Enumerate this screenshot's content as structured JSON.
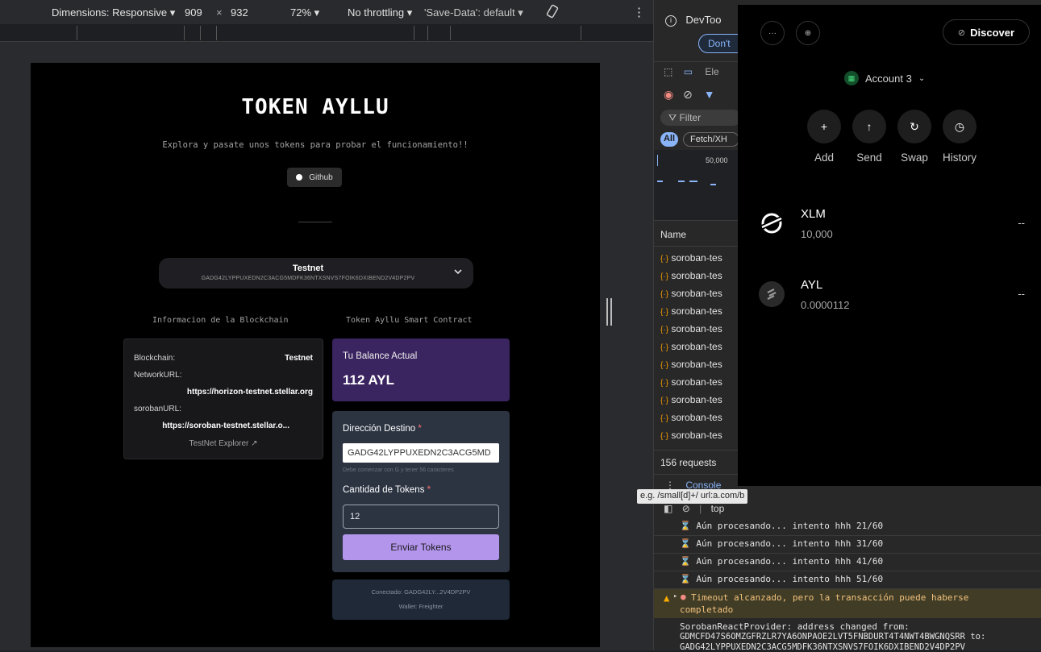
{
  "device_toolbar": {
    "dimensions": "Dimensions: Responsive",
    "width": "909",
    "times": "×",
    "height": "932",
    "zoom": "72%",
    "throttling": "No throttling",
    "save_data": "'Save-Data': default"
  },
  "app": {
    "title": "TOKEN AYLLU",
    "subtitle": "Explora y pasate unos tokens para probar el funcionamiento!!",
    "github_label": "Github",
    "network": {
      "name": "Testnet",
      "address": "GADG42LYPPUXEDN2C3ACG5MDFK36NTXSNVS7FOIK6DXIBEND2V4DP2PV"
    },
    "blockchain_heading": "Informacion de la Blockchain",
    "contract_heading": "Token Ayllu Smart Contract",
    "info": {
      "blockchain_label": "Blockchain:",
      "blockchain_value": "Testnet",
      "network_url_label": "NetworkURL:",
      "network_url_value": "https://horizon-testnet.stellar.org",
      "soroban_url_label": "sorobanURL:",
      "soroban_url_value": "https://soroban-testnet.stellar.o...",
      "explorer_link": "TestNet Explorer ↗"
    },
    "balance": {
      "label": "Tu Balance Actual",
      "value": "112 AYL"
    },
    "form": {
      "dest_label": "Dirección Destino",
      "required_mark": "*",
      "dest_value": "GADG42LYPPUXEDN2C3ACG5MD",
      "dest_help": "Debe comenzar con G y tener 56 caracteres",
      "amount_label": "Cantidad de Tokens",
      "amount_value": "12",
      "send_label": "Enviar Tokens"
    },
    "connection": {
      "connected": "Conectado: GADG42LY...2V4DP2PV",
      "wallet": "Wallet: Freighter"
    }
  },
  "devtools": {
    "title": "DevToo",
    "dont_label": "Don't",
    "elements_tab": "Ele",
    "filter_placeholder": "Filter",
    "filter_all": "All",
    "filter_fetch": "Fetch/XH",
    "timeline_tick": "50,000",
    "name_header": "Name",
    "requests": [
      "soroban-tes",
      "soroban-tes",
      "soroban-tes",
      "soroban-tes",
      "soroban-tes",
      "soroban-tes",
      "soroban-tes",
      "soroban-tes",
      "soroban-tes",
      "soroban-tes",
      "soroban-tes"
    ],
    "requests_count": "156 requests",
    "console_tab": "Console",
    "tooltip": "e.g. /small[d]+/ url:a.com/b",
    "context": "top",
    "logs": [
      "⌛ Aún procesando... intento hhh 21/60",
      "⌛ Aún procesando... intento hhh 31/60",
      "⌛ Aún procesando... intento hhh 41/60",
      "⌛ Aún procesando... intento hhh 51/60"
    ],
    "warning_line1": "Timeout alcanzado, pero la transacción puede haberse",
    "warning_line2": "completado",
    "provider_line1": "SorobanReactProvider: address changed from:",
    "provider_line2": "GDMCFD47S6OMZGFRZLR7YA6ONPAOE2LVT5FNBDURT4T4NWT4BWGNQSRR  to:",
    "provider_line3": "GADG42LYPPUXEDN2C3ACG5MDFK36NTXSNVS7FOIK6DXIBEND2V4DP2PV"
  },
  "wallet": {
    "discover_label": "Discover",
    "account_label": "Account 3",
    "actions": [
      "Add",
      "Send",
      "Swap",
      "History"
    ],
    "assets": [
      {
        "code": "XLM",
        "amount": "10,000",
        "value": "--"
      },
      {
        "code": "AYL",
        "amount": "0.0000112",
        "value": "--"
      }
    ]
  }
}
